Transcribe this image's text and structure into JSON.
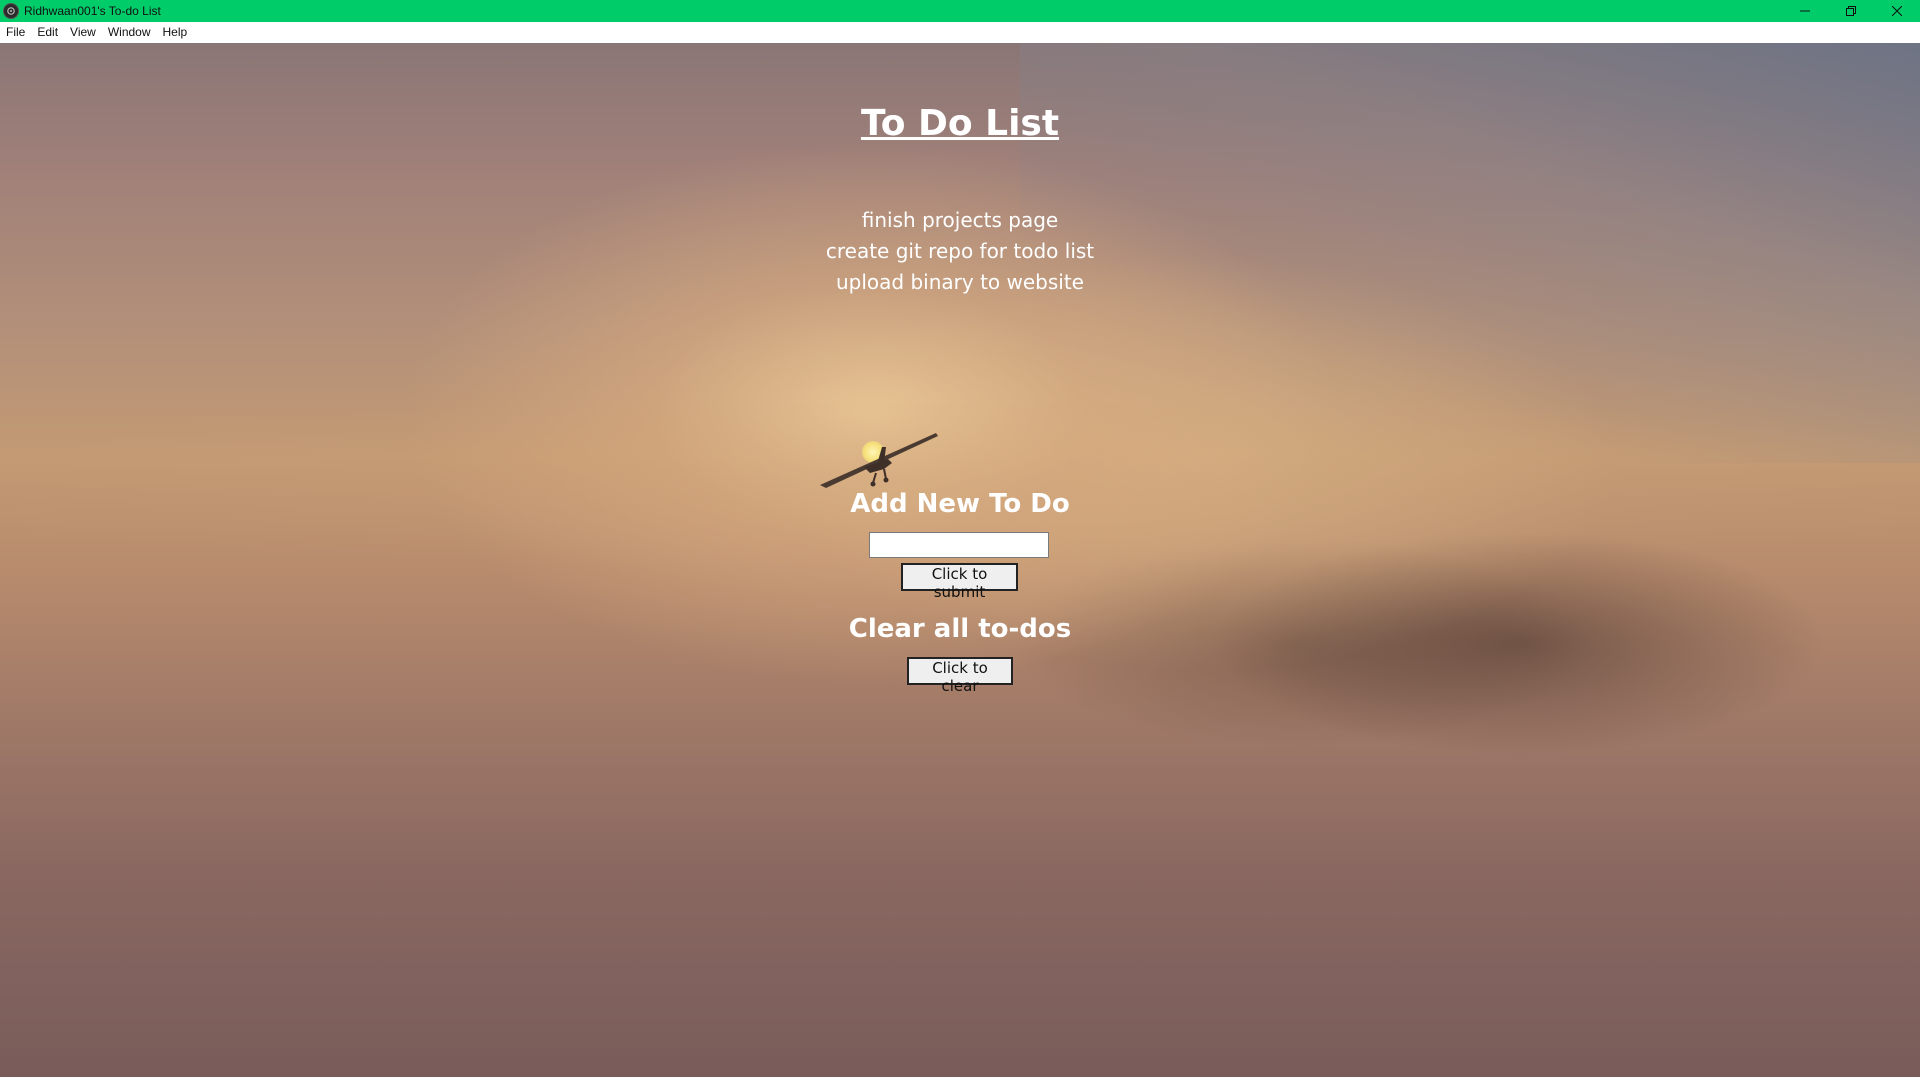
{
  "window": {
    "title": "Ridhwaan001's To-do List",
    "titlebar_color": "#00cc6a",
    "icon": "app-logo-icon",
    "controls": [
      "minimize-icon",
      "restore-icon",
      "close-icon"
    ]
  },
  "menu": {
    "items": [
      "File",
      "Edit",
      "View",
      "Window",
      "Help"
    ]
  },
  "page": {
    "title": "To Do List",
    "todos": [
      "finish projects page",
      "create git repo for todo list",
      "upload binary to website"
    ],
    "add_section": {
      "heading": "Add New To Do",
      "input_value": "",
      "submit_label": "Click to submit"
    },
    "clear_section": {
      "heading": "Clear all to-dos",
      "clear_label": "Click to clear"
    }
  }
}
